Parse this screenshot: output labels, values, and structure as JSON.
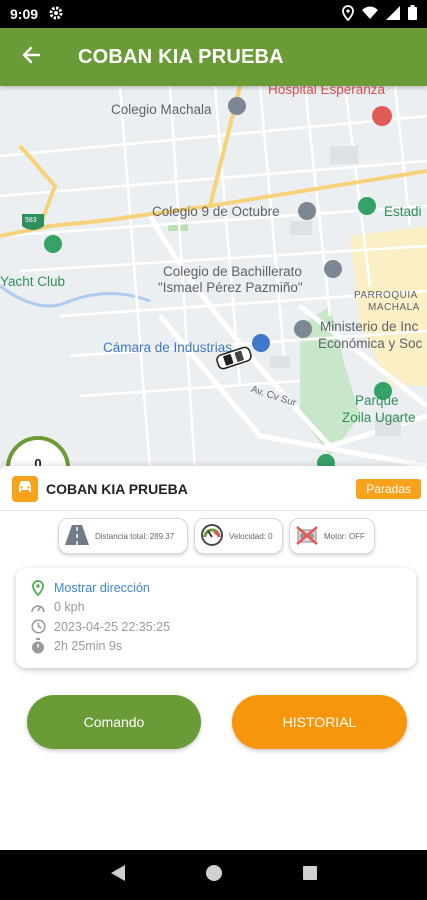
{
  "status_bar": {
    "time": "9:09",
    "icons": [
      "settings-gear-icon",
      "location-icon",
      "wifi-icon",
      "cellular-icon",
      "battery-icon"
    ]
  },
  "app_bar": {
    "title": "COBAN KIA PRUEBA",
    "back_icon": "arrow-back-icon",
    "color": "#6b9b37"
  },
  "map": {
    "labels": {
      "hospital": "Hospital Esperanza",
      "colegio_machala": "Colegio Machala",
      "colegio_9_octubre": "Colegio 9 de Octubre",
      "estadio": "Estadi",
      "yacht_club": "Yacht Club",
      "bachillerato_1": "Colegio de Bachillerato",
      "bachillerato_2": "\"Ismael Pérez Pazmiño\"",
      "parroquia_1": "PARROQUIA",
      "parroquia_2": "MACHALA",
      "ministerio_1": "Ministerio de Inc",
      "ministerio_2": "Económica y Soc",
      "camara": "Cámara de Industrias",
      "avenida": "Av. Cv Sur",
      "parque_1": "Parque",
      "parque_2": "Zoila Ugarte",
      "route_shield": "583"
    },
    "odometer_value": "0"
  },
  "vehicle": {
    "name": "COBAN KIA PRUEBA",
    "status_badge": "Paradas"
  },
  "stats": {
    "distance": "Distancia total: 289.37",
    "speed": "Velocidad: 0",
    "engine": "Motor: OFF"
  },
  "info": {
    "address_link": "Mostrar dirección",
    "speed": "0 kph",
    "datetime": "2023-04-25 22:35:25",
    "duration": "2h 25min 9s"
  },
  "buttons": {
    "comando": "Comando",
    "historial": "HISTORIAL"
  },
  "colors": {
    "primary_green": "#6b9b37",
    "accent_orange": "#f7a21b",
    "link_blue": "#3f86d2"
  }
}
